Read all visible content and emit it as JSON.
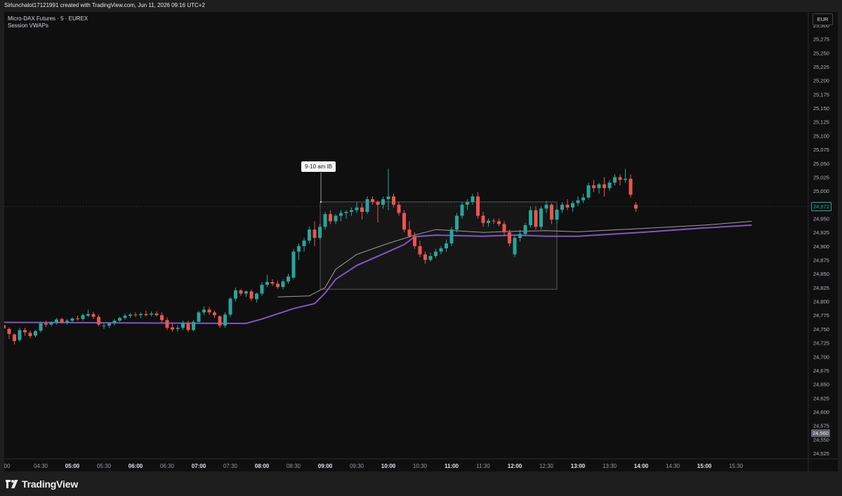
{
  "header": {
    "credit": "Sirlunchalot17121991 created with TradingView.com, Jun 11, 2026 09:16 UTC+2"
  },
  "legend": {
    "symbol_line": "Micro-DAX Futures · 5 · EUREX",
    "indicator": "Session VWAPs"
  },
  "price_axis": {
    "currency": "EUR",
    "ticks": [
      "25,300",
      "25,275",
      "25,250",
      "25,225",
      "25,200",
      "25,175",
      "25,150",
      "25,125",
      "25,100",
      "25,075",
      "25,050",
      "25,025",
      "25,000",
      "24,975",
      "24,950",
      "24,925",
      "24,900",
      "24,875",
      "24,850",
      "24,825",
      "24,800",
      "24,775",
      "24,750",
      "24,725",
      "24,700",
      "24,675",
      "24,650",
      "24,625",
      "24,600",
      "24,575",
      "24,550",
      "24,525"
    ],
    "last_price_label": "24,972",
    "crosshair_price_label": "24,560"
  },
  "time_axis": {
    "labels": [
      {
        "text": "00",
        "bold": false
      },
      {
        "text": "04:30",
        "bold": false
      },
      {
        "text": "05:00",
        "bold": true
      },
      {
        "text": "05:30",
        "bold": false
      },
      {
        "text": "06:00",
        "bold": true
      },
      {
        "text": "06:30",
        "bold": false
      },
      {
        "text": "07:00",
        "bold": true
      },
      {
        "text": "07:30",
        "bold": false
      },
      {
        "text": "08:00",
        "bold": true
      },
      {
        "text": "08:30",
        "bold": false
      },
      {
        "text": "09:00",
        "bold": true
      },
      {
        "text": "09:30",
        "bold": false
      },
      {
        "text": "10:00",
        "bold": true
      },
      {
        "text": "10:30",
        "bold": false
      },
      {
        "text": "11:00",
        "bold": true
      },
      {
        "text": "11:30",
        "bold": false
      },
      {
        "text": "12:00",
        "bold": true
      },
      {
        "text": "12:30",
        "bold": false
      },
      {
        "text": "13:00",
        "bold": true
      },
      {
        "text": "13:30",
        "bold": false
      },
      {
        "text": "14:00",
        "bold": true
      },
      {
        "text": "14:30",
        "bold": false
      },
      {
        "text": "15:00",
        "bold": true
      },
      {
        "text": "15:30",
        "bold": false
      }
    ]
  },
  "annotation": {
    "text": "9-10 am IB",
    "range_high": 24980,
    "range_low": 24822
  },
  "colors": {
    "up": "#26a69a",
    "down": "#ef5350",
    "vwap_primary": "#7e57c2",
    "vwap_secondary": "#9e9e9e",
    "background": "#0f0f0f"
  },
  "chart_data": {
    "type": "candlestick",
    "start_time": "03:55",
    "interval_minutes": 5,
    "ylim": [
      24515,
      25315
    ],
    "candles": [
      [
        24757,
        24762,
        24745,
        24751
      ],
      [
        24750,
        24753,
        24732,
        24741
      ],
      [
        24740,
        24742,
        24722,
        24728
      ],
      [
        24730,
        24752,
        24727,
        24748
      ],
      [
        24748,
        24752,
        24738,
        24744
      ],
      [
        24743,
        24747,
        24733,
        24737
      ],
      [
        24738,
        24749,
        24735,
        24746
      ],
      [
        24747,
        24764,
        24744,
        24760
      ],
      [
        24760,
        24765,
        24753,
        24758
      ],
      [
        24758,
        24764,
        24755,
        24762
      ],
      [
        24762,
        24770,
        24758,
        24767
      ],
      [
        24768,
        24770,
        24760,
        24762
      ],
      [
        24762,
        24768,
        24758,
        24765
      ],
      [
        24765,
        24771,
        24762,
        24769
      ],
      [
        24769,
        24774,
        24765,
        24768
      ],
      [
        24768,
        24778,
        24765,
        24775
      ],
      [
        24774,
        24785,
        24771,
        24777
      ],
      [
        24777,
        24781,
        24768,
        24772
      ],
      [
        24772,
        24776,
        24755,
        24758
      ],
      [
        24755,
        24760,
        24750,
        24756
      ],
      [
        24756,
        24762,
        24752,
        24760
      ],
      [
        24760,
        24768,
        24756,
        24765
      ],
      [
        24765,
        24772,
        24763,
        24770
      ],
      [
        24770,
        24778,
        24767,
        24774
      ],
      [
        24774,
        24779,
        24770,
        24776
      ],
      [
        24776,
        24780,
        24772,
        24775
      ],
      [
        24775,
        24780,
        24770,
        24777
      ],
      [
        24777,
        24783,
        24773,
        24775
      ],
      [
        24776,
        24782,
        24773,
        24778
      ],
      [
        24778,
        24782,
        24773,
        24775
      ],
      [
        24775,
        24780,
        24762,
        24766
      ],
      [
        24766,
        24771,
        24748,
        24752
      ],
      [
        24753,
        24762,
        24745,
        24749
      ],
      [
        24750,
        24757,
        24745,
        24752
      ],
      [
        24752,
        24765,
        24748,
        24761
      ],
      [
        24761,
        24765,
        24745,
        24748
      ],
      [
        24748,
        24766,
        24746,
        24763
      ],
      [
        24763,
        24783,
        24760,
        24780
      ],
      [
        24780,
        24791,
        24775,
        24785
      ],
      [
        24785,
        24790,
        24776,
        24780
      ],
      [
        24780,
        24783,
        24770,
        24775
      ],
      [
        24773,
        24775,
        24752,
        24756
      ],
      [
        24756,
        24780,
        24752,
        24776
      ],
      [
        24776,
        24808,
        24772,
        24805
      ],
      [
        24805,
        24825,
        24800,
        24820
      ],
      [
        24820,
        24822,
        24810,
        24814
      ],
      [
        24814,
        24820,
        24808,
        24818
      ],
      [
        24818,
        24821,
        24801,
        24805
      ],
      [
        24804,
        24816,
        24798,
        24814
      ],
      [
        24814,
        24835,
        24810,
        24830
      ],
      [
        24830,
        24848,
        24826,
        24835
      ],
      [
        24835,
        24840,
        24828,
        24832
      ],
      [
        24832,
        24837,
        24823,
        24826
      ],
      [
        24826,
        24840,
        24822,
        24836
      ],
      [
        24836,
        24850,
        24832,
        24845
      ],
      [
        24843,
        24895,
        24840,
        24890
      ],
      [
        24890,
        24905,
        24875,
        24900
      ],
      [
        24900,
        24915,
        24890,
        24910
      ],
      [
        24910,
        24935,
        24905,
        24930
      ],
      [
        24930,
        24945,
        24900,
        24915
      ],
      [
        24915,
        24940,
        24912,
        24935
      ],
      [
        24935,
        24962,
        24930,
        24958
      ],
      [
        24958,
        24965,
        24940,
        24945
      ],
      [
        24945,
        24958,
        24940,
        24955
      ],
      [
        24955,
        24965,
        24945,
        24960
      ],
      [
        24960,
        24965,
        24950,
        24962
      ],
      [
        24962,
        24970,
        24955,
        24965
      ],
      [
        24965,
        24980,
        24960,
        24970
      ],
      [
        24970,
        24978,
        24948,
        24962
      ],
      [
        24962,
        24990,
        24958,
        24985
      ],
      [
        24985,
        24990,
        24975,
        24980
      ],
      [
        24980,
        24983,
        24943,
        24975
      ],
      [
        24975,
        24990,
        24968,
        24985
      ],
      [
        24985,
        25040,
        24965,
        24990
      ],
      [
        24990,
        24995,
        24970,
        24975
      ],
      [
        24975,
        24980,
        24955,
        24960
      ],
      [
        24960,
        24965,
        24925,
        24930
      ],
      [
        24930,
        24945,
        24915,
        24918
      ],
      [
        24918,
        24925,
        24895,
        24900
      ],
      [
        24900,
        24910,
        24880,
        24885
      ],
      [
        24885,
        24890,
        24868,
        24875
      ],
      [
        24875,
        24888,
        24872,
        24882
      ],
      [
        24882,
        24895,
        24878,
        24890
      ],
      [
        24890,
        24900,
        24885,
        24896
      ],
      [
        24896,
        24912,
        24890,
        24905
      ],
      [
        24905,
        24935,
        24900,
        24930
      ],
      [
        24930,
        24960,
        24925,
        24955
      ],
      [
        24955,
        24980,
        24950,
        24975
      ],
      [
        24975,
        24985,
        24965,
        24980
      ],
      [
        24980,
        24995,
        24975,
        24990
      ],
      [
        24990,
        24998,
        24950,
        24955
      ],
      [
        24955,
        24962,
        24935,
        24942
      ],
      [
        24942,
        24950,
        24935,
        24946
      ],
      [
        24946,
        24950,
        24940,
        24945
      ],
      [
        24945,
        24950,
        24936,
        24940
      ],
      [
        24940,
        24945,
        24918,
        24925
      ],
      [
        24925,
        24930,
        24900,
        24905
      ],
      [
        24885,
        24920,
        24880,
        24915
      ],
      [
        24915,
        24930,
        24908,
        24922
      ],
      [
        24922,
        24942,
        24918,
        24938
      ],
      [
        24938,
        24972,
        24934,
        24965
      ],
      [
        24965,
        24972,
        24930,
        24935
      ],
      [
        24935,
        24972,
        24930,
        24968
      ],
      [
        24968,
        24982,
        24960,
        24975
      ],
      [
        24975,
        24978,
        24940,
        24948
      ],
      [
        24948,
        24970,
        24940,
        24966
      ],
      [
        24966,
        24980,
        24960,
        24975
      ],
      [
        24975,
        24985,
        24965,
        24970
      ],
      [
        24970,
        24982,
        24962,
        24978
      ],
      [
        24978,
        24990,
        24972,
        24983
      ],
      [
        24983,
        24995,
        24978,
        24988
      ],
      [
        24988,
        25015,
        24985,
        25010
      ],
      [
        25010,
        25020,
        24998,
        25005
      ],
      [
        25005,
        25015,
        24995,
        25012
      ],
      [
        25012,
        25025,
        24990,
        25005
      ],
      [
        25005,
        25020,
        25000,
        25015
      ],
      [
        25015,
        25030,
        25010,
        25025
      ],
      [
        25025,
        25030,
        25010,
        25020
      ],
      [
        25020,
        25040,
        25015,
        25022
      ],
      [
        25022,
        25030,
        24988,
        24993
      ],
      [
        24975,
        24980,
        24962,
        24968
      ]
    ],
    "vwap_primary": [
      {
        "t": "03:55",
        "v": 24762
      },
      {
        "t": "07:45",
        "v": 24760
      },
      {
        "t": "08:00",
        "v": 24768
      },
      {
        "t": "08:30",
        "v": 24787
      },
      {
        "t": "08:50",
        "v": 24796
      },
      {
        "t": "09:00",
        "v": 24815
      },
      {
        "t": "09:10",
        "v": 24840
      },
      {
        "t": "09:30",
        "v": 24865
      },
      {
        "t": "10:00",
        "v": 24890
      },
      {
        "t": "10:15",
        "v": 24903
      },
      {
        "t": "10:25",
        "v": 24917
      },
      {
        "t": "10:45",
        "v": 24920
      },
      {
        "t": "11:30",
        "v": 24918
      },
      {
        "t": "12:00",
        "v": 24920
      },
      {
        "t": "12:30",
        "v": 24918
      },
      {
        "t": "13:00",
        "v": 24918
      },
      {
        "t": "14:00",
        "v": 24925
      },
      {
        "t": "15:00",
        "v": 24933
      },
      {
        "t": "15:45",
        "v": 24938
      }
    ],
    "vwap_secondary": [
      {
        "t": "08:15",
        "v": 24808
      },
      {
        "t": "08:45",
        "v": 24810
      },
      {
        "t": "09:00",
        "v": 24825
      },
      {
        "t": "09:10",
        "v": 24858
      },
      {
        "t": "09:30",
        "v": 24885
      },
      {
        "t": "10:00",
        "v": 24905
      },
      {
        "t": "10:25",
        "v": 24920
      },
      {
        "t": "10:45",
        "v": 24930
      },
      {
        "t": "11:30",
        "v": 24925
      },
      {
        "t": "12:00",
        "v": 24927
      },
      {
        "t": "12:30",
        "v": 24928
      },
      {
        "t": "13:00",
        "v": 24926
      },
      {
        "t": "14:00",
        "v": 24932
      },
      {
        "t": "15:00",
        "v": 24938
      },
      {
        "t": "15:45",
        "v": 24945
      }
    ]
  },
  "footer": {
    "brand": "TradingView"
  }
}
